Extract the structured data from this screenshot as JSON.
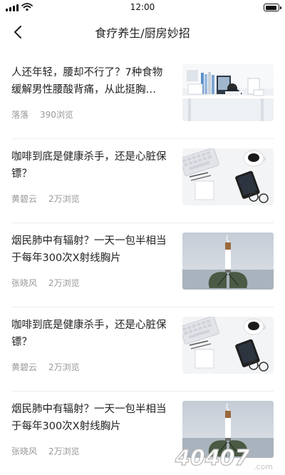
{
  "status_bar": {
    "time": "12:00"
  },
  "nav": {
    "title": "食疗养生/厨房妙招"
  },
  "articles": [
    {
      "title": "人还年轻，腰却不行了？7种食物缓解男性腰酸背痛，从此挺胸…",
      "author": "落落",
      "views": "390浏览",
      "image": "office-desk-image"
    },
    {
      "title": "咖啡到底是健康杀手，还是心脏保镖？",
      "author": "黄碧云",
      "views": "2万浏览",
      "image": "coffee-desk-image"
    },
    {
      "title": "烟民肺中有辐射？一天一包半相当于每年300次X射线胸片",
      "author": "张晓风",
      "views": "2万浏览",
      "image": "cigarette-lungs-image"
    },
    {
      "title": "咖啡到底是健康杀手，还是心脏保镖？",
      "author": "黄碧云",
      "views": "2万浏览",
      "image": "coffee-desk-image"
    },
    {
      "title": "烟民肺中有辐射？一天一包半相当于每年300次X射线胸片",
      "author": "张晓风",
      "views": "2万浏览",
      "image": "cigarette-lungs-image"
    }
  ],
  "watermark": {
    "text": "40407",
    "domain": ".com"
  }
}
